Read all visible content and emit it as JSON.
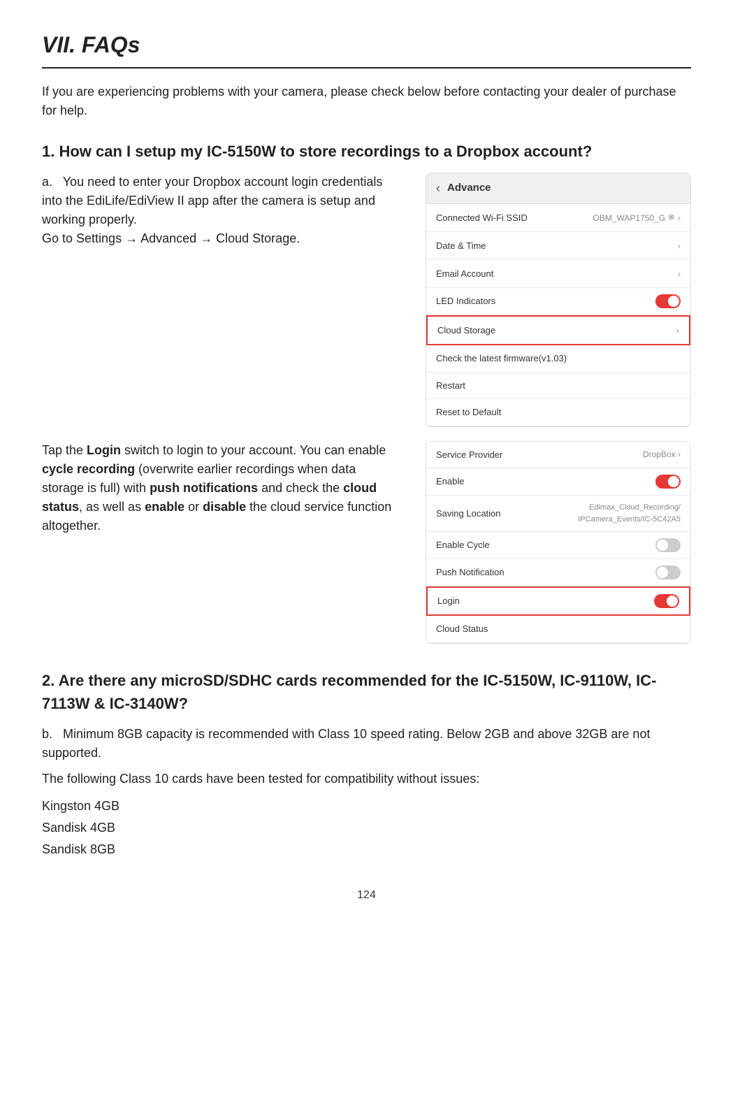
{
  "page": {
    "title": "VII. FAQs",
    "page_number": "124",
    "intro": "If you are experiencing problems with your camera, please check below before contacting your dealer of purchase for help."
  },
  "section1": {
    "heading": "1. How can I setup my IC-5150W to store recordings to a Dropbox account?",
    "subLabel": "a.",
    "para1": "You need to enter your Dropbox account login credentials into the EdiLife/EdiView II app after the camera is setup and working properly.",
    "settingsPath": "Go to Settings → Advanced → Cloud Storage.",
    "para2_prefix": "Tap the ",
    "login_bold": "Login",
    "para2_mid": " switch to login to your account. You can enable ",
    "cycle_bold": "cycle recording",
    "para2_cont": " (overwrite earlier recordings when data storage is full) with ",
    "push_bold": "push notifications",
    "para2_cont2": " and check the ",
    "cloud_bold": "cloud status",
    "para2_cont3": ", as well as ",
    "enable_bold": "enable",
    "para2_or": " or ",
    "disable_bold": "disable",
    "para2_end": " the cloud service function altogether."
  },
  "screenshot1": {
    "header_back": "‹",
    "header_title": "Advance",
    "rows": [
      {
        "label": "Connected Wi-Fi SSID",
        "value": "OBM_WAP1750_G",
        "type": "value-chevron"
      },
      {
        "label": "Date & Time",
        "value": "",
        "type": "chevron"
      },
      {
        "label": "Email Account",
        "value": "",
        "type": "chevron"
      },
      {
        "label": "LED Indicators",
        "value": "",
        "type": "toggle-on"
      },
      {
        "label": "Cloud Storage",
        "value": "",
        "type": "chevron-highlight"
      },
      {
        "label": "Check the latest firmware(v1.03)",
        "value": "",
        "type": "plain"
      },
      {
        "label": "Restart",
        "value": "",
        "type": "plain"
      },
      {
        "label": "Reset to Default",
        "value": "",
        "type": "plain"
      }
    ]
  },
  "screenshot2": {
    "rows": [
      {
        "label": "Service Provider",
        "value": "DropBox ›",
        "type": "value"
      },
      {
        "label": "Enable",
        "value": "",
        "type": "toggle-on"
      },
      {
        "label": "Saving Location",
        "value": "Edimax_Cloud_Recording/IPCamera_Events/IC-5C42A5",
        "type": "storage"
      },
      {
        "label": "Enable Cycle",
        "value": "",
        "type": "toggle-off"
      },
      {
        "label": "Push Notification",
        "value": "",
        "type": "toggle-off"
      },
      {
        "label": "Login",
        "value": "",
        "type": "toggle-on-highlight"
      },
      {
        "label": "Cloud Status",
        "value": "",
        "type": "plain"
      }
    ]
  },
  "section2": {
    "heading": "2. Are there any microSD/SDHC cards recommended for the IC-5150W, IC-9110W, IC-7113W & IC-3140W?",
    "subLabel": "b.",
    "para1": "Minimum 8GB capacity is recommended with Class 10 speed rating. Below 2GB and above 32GB are not supported.",
    "para2": "The following Class 10 cards have been tested for compatibility without issues:",
    "cards": [
      "Kingston 4GB",
      "Sandisk 4GB",
      "Sandisk 8GB"
    ]
  }
}
